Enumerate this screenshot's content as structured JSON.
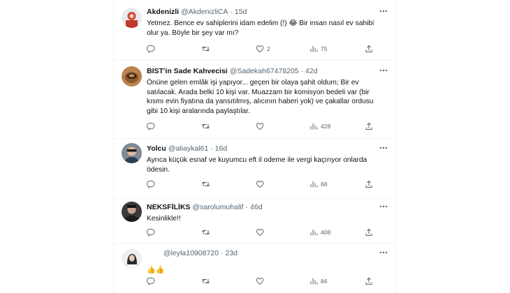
{
  "replies": [
    {
      "name": "Akdenizli",
      "handle": "@AkdenizliCA",
      "time": "15d",
      "lines": [
        "Yetmez. Bence ev sahiplerini idam edelim (!) 😂 Bir insan nasıl ev sahibi",
        "olur ya. Böyle bir şey var mı?"
      ],
      "replies_count": "",
      "retweets_count": "",
      "likes_count": "2",
      "views_count": "75"
    },
    {
      "name": "BIST'in Sade Kahvecisi",
      "handle": "@Sadekah67478205",
      "time": "42d",
      "lines": [
        "Önüne gelen emlâk işi yapıyor... geçen bir olaya şahit oldum; Bir ev",
        "satılacak. Arada belki 10 kişi var. Muazzam bir komisyon bedeli var (bir",
        "kısmı evin fiyatına da yansıtılmış, alıcının haberi yok) ve çakallar ordusu",
        "gibi 10 kişi aralarında paylaştılar."
      ],
      "replies_count": "",
      "retweets_count": "",
      "likes_count": "",
      "views_count": "428"
    },
    {
      "name": "Yolcu",
      "handle": "@aliaykal61",
      "time": "16d",
      "lines": [
        "Ayrıca küçük esnaf ve kuyumcu eft il odeme ile vergi kaçırıyor onlarda",
        "ödesin."
      ],
      "replies_count": "",
      "retweets_count": "",
      "likes_count": "",
      "views_count": "68"
    },
    {
      "name": "NEKSFİLİKS",
      "handle": "@sarolumuhalif",
      "time": "46d",
      "lines": [
        "Kesinlikle!!"
      ],
      "replies_count": "",
      "retweets_count": "",
      "likes_count": "",
      "views_count": "408"
    },
    {
      "name": "",
      "handle": "@leyla10908720",
      "time": "23d",
      "lines": [
        "👍👍"
      ],
      "replies_count": "",
      "retweets_count": "",
      "likes_count": "",
      "views_count": "84"
    }
  ],
  "icons": {
    "reply": "comment-bubble-icon",
    "retweet": "retweet-icon",
    "like": "heart-icon",
    "views": "views-bar-chart-icon",
    "share": "share-upload-icon",
    "more": "more-horizontal-icon"
  },
  "colors": {
    "text": "#0f1419",
    "muted": "#536471",
    "divider": "#eff3f4"
  }
}
